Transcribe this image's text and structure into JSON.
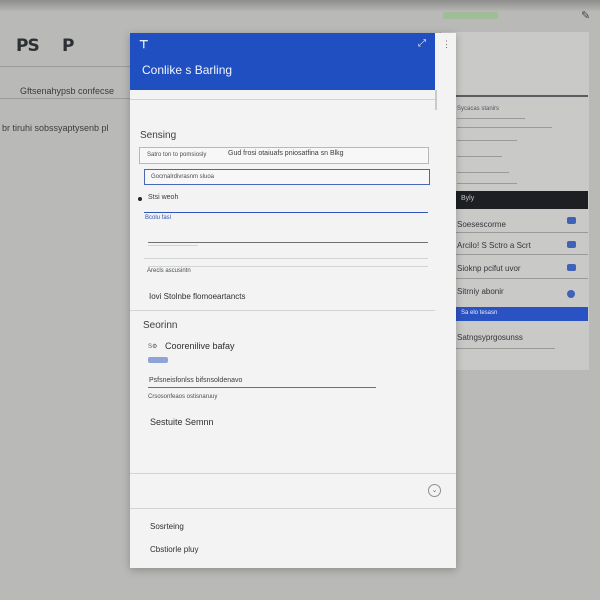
{
  "background": {
    "logo_left": "PS",
    "logo_right": "P",
    "bar_text": "Gftsenahypsb confecse",
    "subtitle_text": "br tiruhi sobssyaptysenb pl"
  },
  "side_panel": {
    "title_lines": [
      "",
      ""
    ],
    "small_items": [
      "Sycacas stanirs",
      "",
      "",
      ""
    ],
    "dark_band": "Byly",
    "rows": [
      "Soesescorme",
      "Arcilo! S Sctro a Scrt",
      "Sioknp pcifut uvor",
      "Sitrniy abonir"
    ],
    "blue_bar": "Sa elo tesasn",
    "footer_row": "Satngsyprgosunss"
  },
  "dialog": {
    "header_title": "Conlike s Barling",
    "section_1": "Sensing",
    "row_1_left": "Satro ton to pomsiosly",
    "row_1_right": "Gud frosi otaiuafs pniosatfina sn Blkg",
    "field_1_value": "Gocmalrdivrasnm sluoa",
    "radio_label": "Stsi weoh",
    "blue_link": "Bcolu fasl",
    "hint_1": "Arecls ascusintn",
    "line_item": "Iovi Stolnbe flomoeartancts",
    "section_2": "Seorinn",
    "chip_label": "Coorenilive bafay",
    "desc_1": "Psfsneisfonlss bifsnsoldenavo",
    "desc_2": "Crsosonfeaos ostisnaruuy",
    "section_3": "Sestuite Semnn",
    "footer_1": "Sosrteing",
    "footer_2": "Cbstiorle pluy"
  },
  "colors": {
    "accent": "#1f4fc0",
    "dialog_bg": "#f2f3f2",
    "page_bg": "#b9bab8"
  }
}
